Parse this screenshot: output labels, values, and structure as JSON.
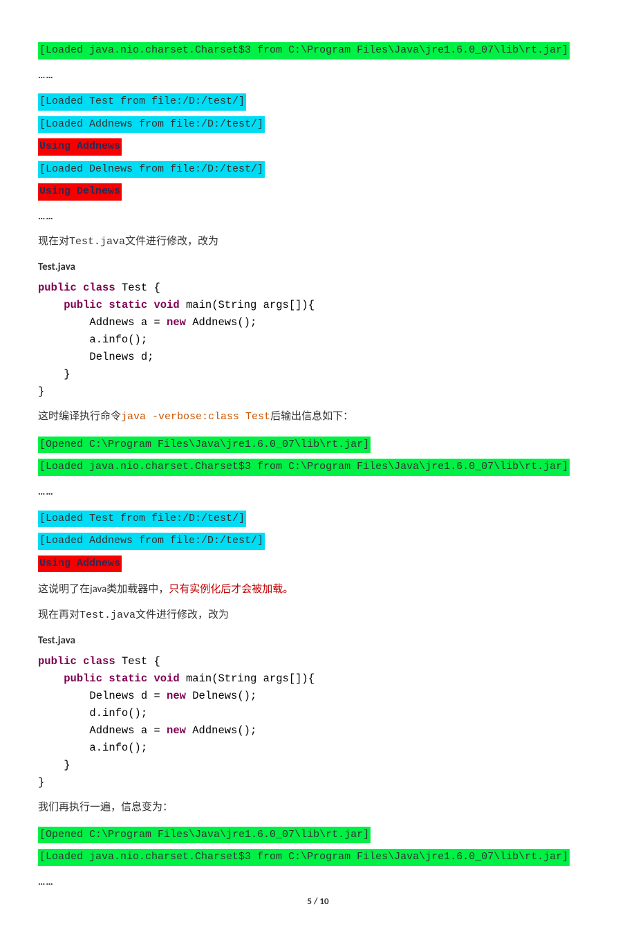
{
  "log1": {
    "l1": "[Loaded java.nio.charset.Charset$3 from C:\\Program Files\\Java\\jre1.6.0_07\\lib\\rt.jar]",
    "dots1": "……",
    "l2": "[Loaded Test from file:/D:/test/]",
    "l3": "[Loaded Addnews from file:/D:/test/]",
    "l4": "Using Addnews",
    "l5": "[Loaded Delnews from file:/D:/test/]",
    "l6": "Using Delnews",
    "dots2": "……"
  },
  "text1": {
    "p1_a": "现在对",
    "p1_b": "Test.java",
    "p1_c": "文件进行修改，改为",
    "head": "Test.java"
  },
  "code1": {
    "l1a": "public",
    "l1b": "class",
    "l1c": " Test {",
    "l2a": "    ",
    "l2b": "public",
    "l2c": "static",
    "l2d": "void",
    "l2e": " main(String args[]){",
    "l3a": "        Addnews a = ",
    "l3b": "new",
    "l3c": " Addnews();",
    "l4": "        a.info();",
    "l5": "        Delnews d;",
    "l6": "    }",
    "l7": "}"
  },
  "text2": {
    "p_a": "这时编译执行命令",
    "p_b": "java -verbose:class Test",
    "p_c": "后输出信息如下："
  },
  "log2": {
    "l1": "[Opened C:\\Program Files\\Java\\jre1.6.0_07\\lib\\rt.jar]",
    "l2": "[Loaded java.nio.charset.Charset$3 from C:\\Program Files\\Java\\jre1.6.0_07\\lib\\rt.jar]",
    "dots1": "……",
    "l3": "[Loaded Test from file:/D:/test/]",
    "l4": "[Loaded Addnews from file:/D:/test/]",
    "l5": "Using Addnews"
  },
  "text3": {
    "p1_a": "这说明了在java类加载器中，",
    "p1_b": "只有实例化后才会被加载。",
    "p2_a": "现在再对",
    "p2_b": "Test.java",
    "p2_c": "文件进行修改，改为",
    "head": "Test.java"
  },
  "code2": {
    "l1a": "public",
    "l1b": "class",
    "l1c": " Test {",
    "l2a": "    ",
    "l2b": "public",
    "l2c": "static",
    "l2d": "void",
    "l2e": " main(String args[]){",
    "l3a": "        Delnews d = ",
    "l3b": "new",
    "l3c": " Delnews();",
    "l4": "        d.info();",
    "l5a": "        Addnews a = ",
    "l5b": "new",
    "l5c": " Addnews();",
    "l6": "        a.info();",
    "l7": "    }",
    "l8": "}"
  },
  "text4": {
    "p1": "我们再执行一遍，信息变为："
  },
  "log3": {
    "l1": "[Opened C:\\Program Files\\Java\\jre1.6.0_07\\lib\\rt.jar]",
    "l2": "[Loaded java.nio.charset.Charset$3 from C:\\Program Files\\Java\\jre1.6.0_07\\lib\\rt.jar]",
    "dots1": "……"
  },
  "footer": {
    "page": "5 / 10"
  }
}
